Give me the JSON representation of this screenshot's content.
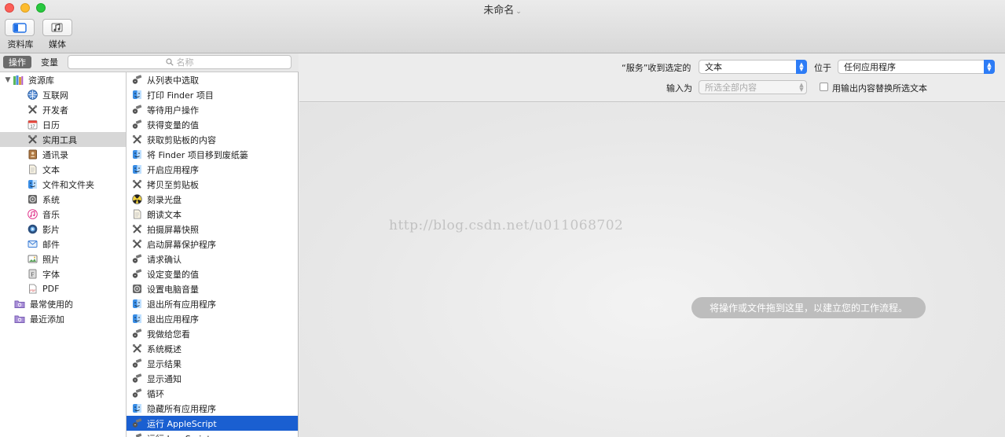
{
  "window": {
    "title": "未命名"
  },
  "toolbar": {
    "library_label": "资料库",
    "media_label": "媒体"
  },
  "left_header": {
    "tab_actions": "操作",
    "tab_variables": "变量",
    "search_placeholder": "名称"
  },
  "library": {
    "root": "资源库",
    "items": [
      {
        "label": "互联网",
        "icon": "globe-icon"
      },
      {
        "label": "开发者",
        "icon": "tools-icon"
      },
      {
        "label": "日历",
        "icon": "calendar-icon"
      },
      {
        "label": "实用工具",
        "icon": "tools-icon",
        "selected": true
      },
      {
        "label": "通讯录",
        "icon": "contacts-icon"
      },
      {
        "label": "文本",
        "icon": "document-icon"
      },
      {
        "label": "文件和文件夹",
        "icon": "finder-icon"
      },
      {
        "label": "系统",
        "icon": "system-icon"
      },
      {
        "label": "音乐",
        "icon": "music-icon"
      },
      {
        "label": "影片",
        "icon": "movie-icon"
      },
      {
        "label": "邮件",
        "icon": "mail-icon"
      },
      {
        "label": "照片",
        "icon": "photos-icon"
      },
      {
        "label": "字体",
        "icon": "font-icon"
      },
      {
        "label": "PDF",
        "icon": "pdf-icon"
      }
    ],
    "smart": [
      {
        "label": "最常使用的",
        "icon": "smart-folder-icon"
      },
      {
        "label": "最近添加",
        "icon": "smart-folder-icon"
      }
    ]
  },
  "actions": [
    {
      "label": "从列表中选取",
      "icon": "automator-icon"
    },
    {
      "label": "打印 Finder 项目",
      "icon": "finder-icon"
    },
    {
      "label": "等待用户操作",
      "icon": "automator-icon"
    },
    {
      "label": "获得变量的值",
      "icon": "automator-icon"
    },
    {
      "label": "获取剪贴板的内容",
      "icon": "tools-icon"
    },
    {
      "label": "将 Finder 项目移到废纸篓",
      "icon": "finder-icon"
    },
    {
      "label": "开启应用程序",
      "icon": "finder-icon"
    },
    {
      "label": "拷贝至剪贴板",
      "icon": "tools-icon"
    },
    {
      "label": "刻录光盘",
      "icon": "burn-icon"
    },
    {
      "label": "朗读文本",
      "icon": "document-icon"
    },
    {
      "label": "拍摄屏幕快照",
      "icon": "tools-icon"
    },
    {
      "label": "启动屏幕保护程序",
      "icon": "tools-icon"
    },
    {
      "label": "请求确认",
      "icon": "automator-icon"
    },
    {
      "label": "设定变量的值",
      "icon": "automator-icon"
    },
    {
      "label": "设置电脑音量",
      "icon": "system-icon"
    },
    {
      "label": "退出所有应用程序",
      "icon": "finder-icon"
    },
    {
      "label": "退出应用程序",
      "icon": "finder-icon"
    },
    {
      "label": "我做给您看",
      "icon": "automator-icon"
    },
    {
      "label": "系统概述",
      "icon": "tools-icon"
    },
    {
      "label": "显示结果",
      "icon": "automator-icon"
    },
    {
      "label": "显示通知",
      "icon": "automator-icon"
    },
    {
      "label": "循环",
      "icon": "automator-icon"
    },
    {
      "label": "隐藏所有应用程序",
      "icon": "finder-icon"
    },
    {
      "label": "运行 AppleScript",
      "icon": "automator-icon",
      "selected": true
    },
    {
      "label": "运行 JavaScript",
      "icon": "automator-icon"
    }
  ],
  "service": {
    "receives_label": "“服务”收到选定的",
    "receives_value": "文本",
    "in_label": "位于",
    "in_value": "任何应用程序",
    "input_is_label": "输入为",
    "input_is_value": "所选全部内容",
    "replace_label": "用输出内容替换所选文本",
    "replace_checked": false
  },
  "canvas": {
    "hint": "将操作或文件拖到这里，以建立您的工作流程。",
    "watermark": "http://blog.csdn.net/u011068702"
  },
  "colors": {
    "selection_blue": "#1a5fd1",
    "popup_blue": "#2d7cf6"
  }
}
